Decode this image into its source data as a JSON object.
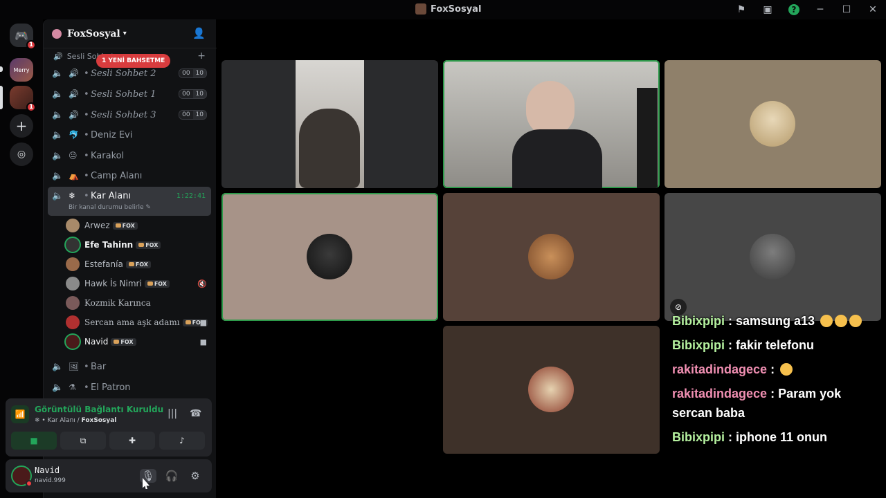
{
  "window": {
    "title": "FoxSosyal"
  },
  "servers": {
    "badge_home": "1",
    "badge_server": "1",
    "server_a_label": "Merry"
  },
  "guild": {
    "name": "FoxSosyal",
    "category": "Sesli Sohbet",
    "new_mention": "1 YENİ BAHSETME"
  },
  "channels": [
    {
      "name": "Sesli Sohbet 2",
      "left": "00",
      "right": "10"
    },
    {
      "name": "Sesli Sohbet 1",
      "left": "00",
      "right": "10"
    },
    {
      "name": "Sesli Sohbet 3",
      "left": "00",
      "right": "10"
    },
    {
      "name": "Deniz Evi"
    },
    {
      "name": "Karakol"
    },
    {
      "name": "Camp Alanı"
    },
    {
      "name": "Kar Alanı",
      "timer": "1:22:41",
      "status": "Bir kanal durumu belirle"
    },
    {
      "name": "Bar"
    },
    {
      "name": "El Patron"
    }
  ],
  "voice_users": [
    {
      "name": "Arwez",
      "tag": "FOX"
    },
    {
      "name": "Efe Tahinn",
      "tag": "FOX"
    },
    {
      "name": "Estefanía",
      "tag": "FOX"
    },
    {
      "name": "Hawk İs Nimri",
      "tag": "FOX"
    },
    {
      "name": "Kozmik Karınca"
    },
    {
      "name": "Sercan ama aşk adamı",
      "tag": "FOX"
    },
    {
      "name": "Navid",
      "tag": "FOX"
    }
  ],
  "voice_panel": {
    "title": "Görüntülü Bağlantı Kuruldu",
    "channel": "Kar Alanı",
    "separator": " / ",
    "server": "FoxSosyal"
  },
  "user": {
    "name": "Navid",
    "handle": "navid.999"
  },
  "chat": [
    {
      "user": "Bibixpipi",
      "sep": " : ",
      "text": "samsung a13"
    },
    {
      "user": "Bibixpipi",
      "sep": " : ",
      "text": "fakir telefonu"
    },
    {
      "user": "rakitadindagece",
      "sep": " : ",
      "text": ""
    },
    {
      "user": "rakitadindagece",
      "sep": " : ",
      "text": "Param yok"
    },
    {
      "user": "",
      "sep": "",
      "text": "sercan baba"
    },
    {
      "user": "Bibixpipi",
      "sep": " : ",
      "text": "iphone 11 onun"
    }
  ],
  "colors": {
    "accent_green": "#23a55a",
    "danger_red": "#da373c",
    "background": "#000000"
  }
}
